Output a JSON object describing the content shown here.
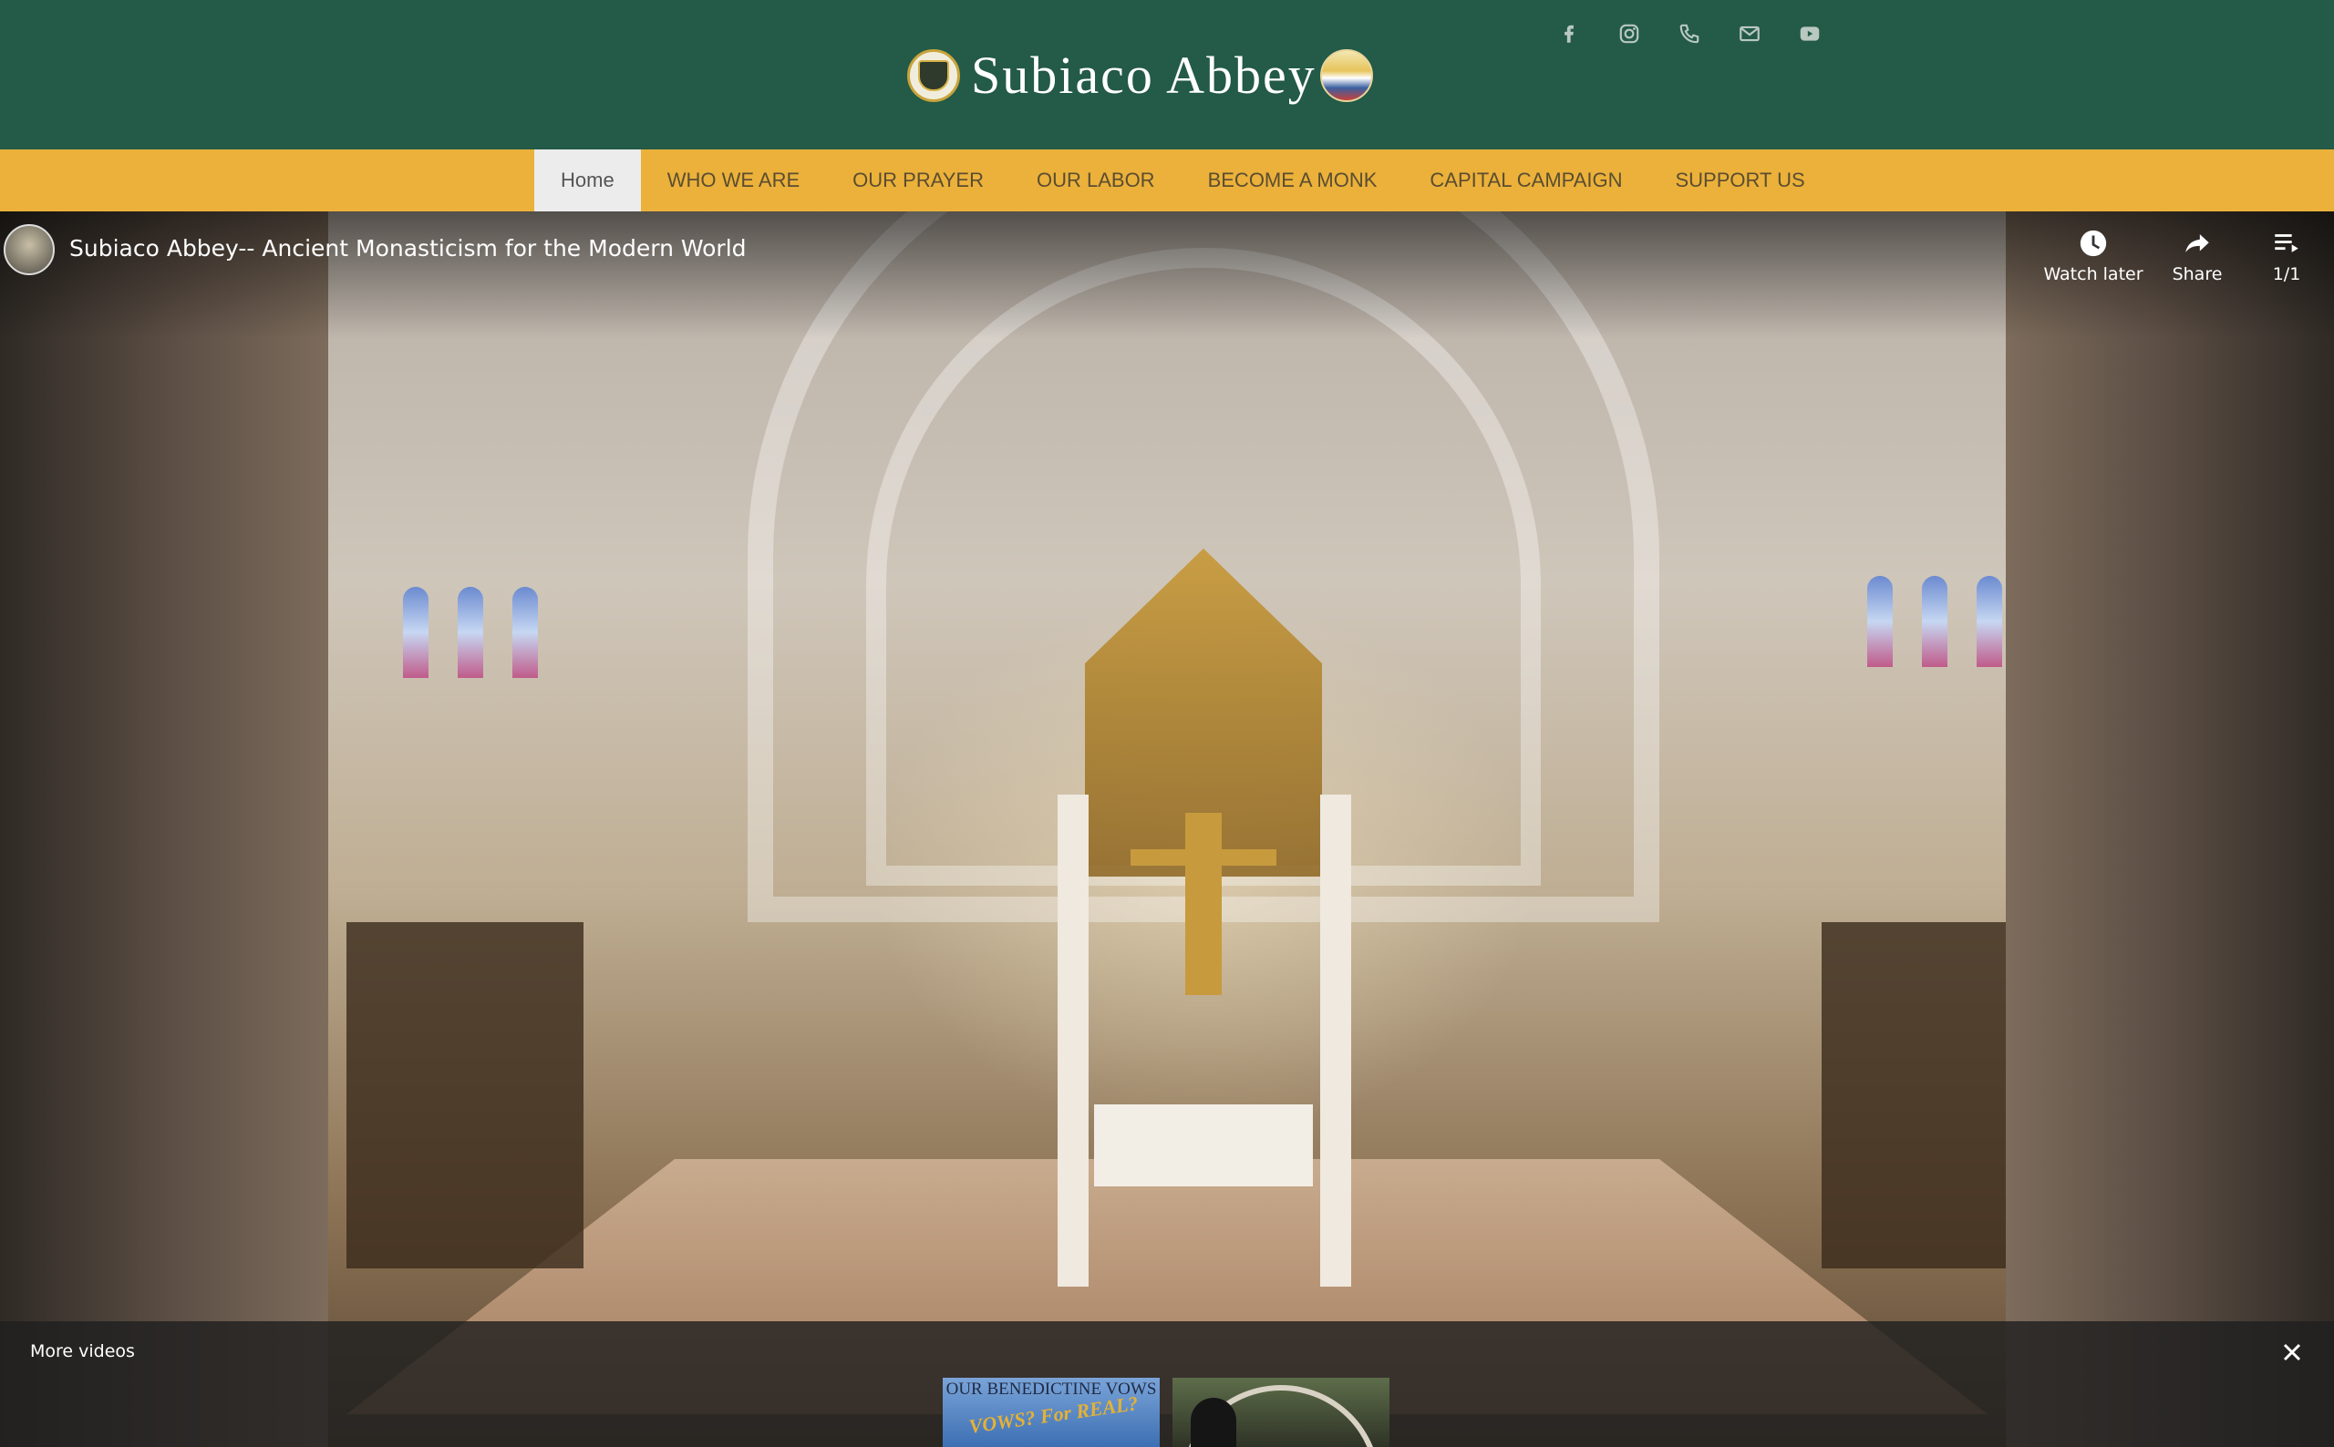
{
  "site": {
    "name": "Subiaco Abbey",
    "colors": {
      "header_bg": "#235a48",
      "nav_bg": "#ebb13a",
      "nav_active_bg": "#ececec",
      "nav_text": "#5b4d31"
    }
  },
  "social": [
    {
      "icon": "facebook-icon"
    },
    {
      "icon": "instagram-icon"
    },
    {
      "icon": "phone-icon"
    },
    {
      "icon": "email-icon"
    },
    {
      "icon": "youtube-icon"
    }
  ],
  "nav": {
    "items": [
      {
        "label": "Home",
        "active": true
      },
      {
        "label": "WHO WE ARE"
      },
      {
        "label": "OUR PRAYER"
      },
      {
        "label": "OUR LABOR"
      },
      {
        "label": "BECOME A MONK"
      },
      {
        "label": "CAPITAL CAMPAIGN"
      },
      {
        "label": "SUPPORT US"
      }
    ]
  },
  "video": {
    "title": "Subiaco Abbey-- Ancient Monasticism for the Modern World",
    "watch_later": "Watch later",
    "share": "Share",
    "playlist_count": "1/1"
  },
  "more_videos": {
    "label": "More videos",
    "thumbs": [
      {
        "line1": "OUR BENEDICTINE VOWS",
        "line2": "VOWS? For REAL?"
      },
      {
        "line1": ""
      }
    ]
  }
}
